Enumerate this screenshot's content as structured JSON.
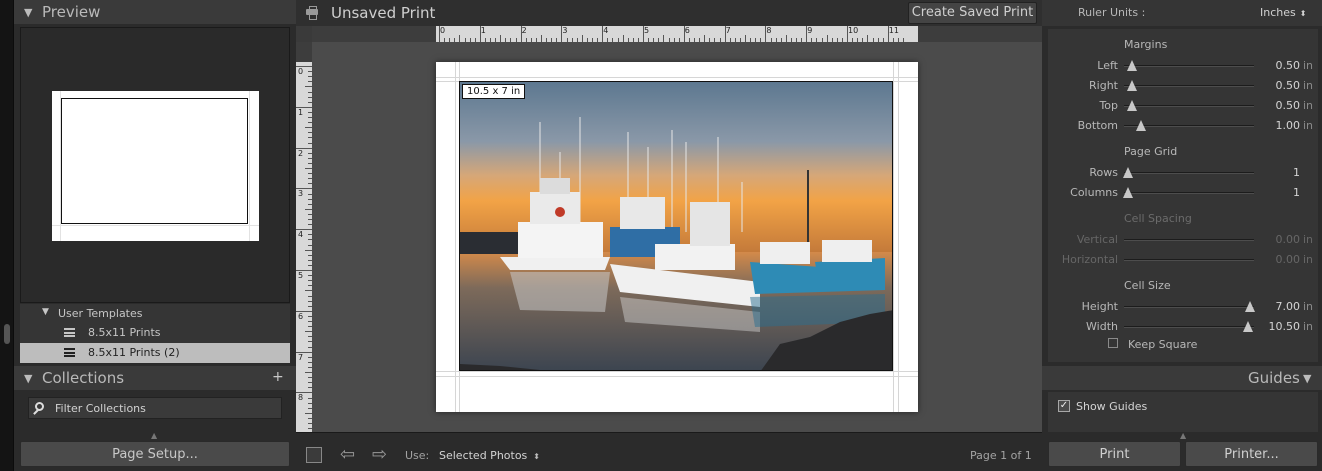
{
  "left_panel": {
    "preview_title": "Preview",
    "templates": [
      {
        "label": "User Templates",
        "type": "folder"
      },
      {
        "label": "8.5x11 Prints",
        "type": "template"
      },
      {
        "label": "8.5x11 Prints (2)",
        "type": "template",
        "selected": true
      }
    ],
    "collections_title": "Collections",
    "add_icon": "plus-icon",
    "filter_placeholder": "Filter Collections",
    "page_setup_label": "Page Setup..."
  },
  "center": {
    "doc_title": "Unsaved Print",
    "create_saved_label": "Create Saved Print",
    "ruler_h": [
      "0",
      "1",
      "2",
      "3",
      "4",
      "5",
      "6",
      "7",
      "8",
      "9",
      "10",
      "11"
    ],
    "ruler_v": [
      "0",
      "1",
      "2",
      "3",
      "4",
      "5",
      "6",
      "7",
      "8"
    ],
    "photo_size_label": "10.5 x 7 in",
    "use_label": "Use:",
    "use_value": "Selected Photos",
    "page_count": "Page 1 of 1"
  },
  "right_panel": {
    "ruler_units_label": "Ruler Units :",
    "ruler_units_value": "Inches",
    "margins_title": "Margins",
    "margins": [
      {
        "label": "Left",
        "value": "0.50",
        "unit": "in",
        "level": 0.06
      },
      {
        "label": "Right",
        "value": "0.50",
        "unit": "in",
        "level": 0.06
      },
      {
        "label": "Top",
        "value": "0.50",
        "unit": "in",
        "level": 0.06
      },
      {
        "label": "Bottom",
        "value": "1.00",
        "unit": "in",
        "level": 0.13
      }
    ],
    "page_grid_title": "Page Grid",
    "page_grid": [
      {
        "label": "Rows",
        "value": "1",
        "unit": "",
        "level": 0.03
      },
      {
        "label": "Columns",
        "value": "1",
        "unit": "",
        "level": 0.03
      }
    ],
    "cell_spacing_title": "Cell Spacing",
    "cell_spacing": [
      {
        "label": "Vertical",
        "value": "0.00",
        "unit": "in"
      },
      {
        "label": "Horizontal",
        "value": "0.00",
        "unit": "in"
      }
    ],
    "cell_size_title": "Cell Size",
    "cell_size": [
      {
        "label": "Height",
        "value": "7.00",
        "unit": "in",
        "level": 0.97
      },
      {
        "label": "Width",
        "value": "10.50",
        "unit": "in",
        "level": 0.95
      }
    ],
    "keep_square_label": "Keep Square",
    "guides_title": "Guides",
    "show_guides_label": "Show Guides",
    "show_guides_checked": true,
    "print_label": "Print",
    "printer_label": "Printer..."
  }
}
